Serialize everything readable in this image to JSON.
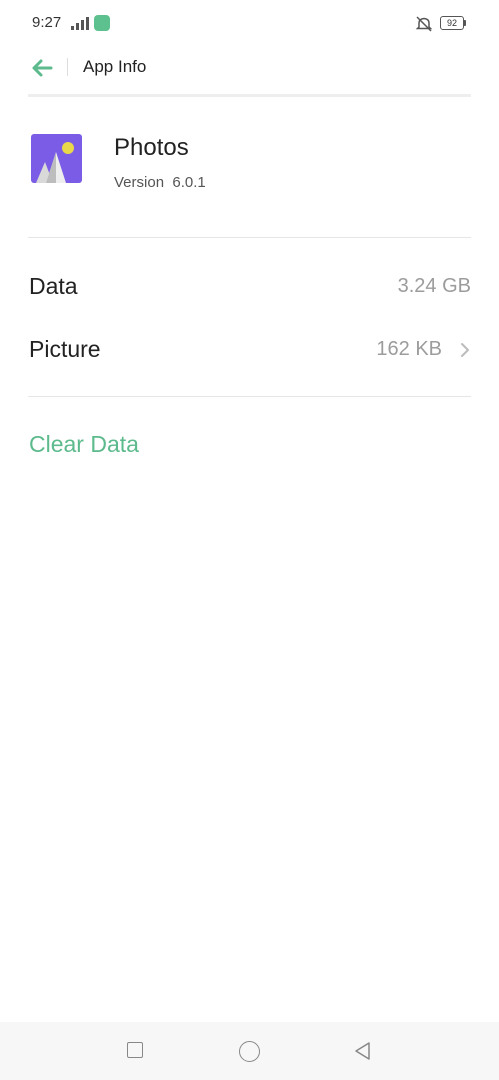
{
  "status_bar": {
    "time": "9:27",
    "battery_level": "92",
    "icons": [
      "signal-icon",
      "notification-app-icon",
      "mute-icon",
      "battery-icon"
    ]
  },
  "header": {
    "title": "App Info",
    "back_icon": "arrow-left-icon"
  },
  "app": {
    "name": "Photos",
    "version_label": "Version",
    "version_number": "6.0.1",
    "icon": "photos-app-icon"
  },
  "storage": {
    "rows": [
      {
        "label": "Data",
        "value": "3.24 GB"
      },
      {
        "label": "Picture",
        "value": "162 KB"
      }
    ]
  },
  "actions": {
    "clear_data": "Clear Data"
  },
  "nav_bar": {
    "buttons": [
      "recents-button",
      "home-button",
      "back-button"
    ]
  },
  "colors": {
    "accent": "#5cba8c",
    "app_icon_bg": "#7b5ce6",
    "app_icon_sun": "#e8d84a",
    "text_primary": "#222222",
    "text_secondary": "#9c9c9c",
    "divider": "#e6e6e6"
  }
}
